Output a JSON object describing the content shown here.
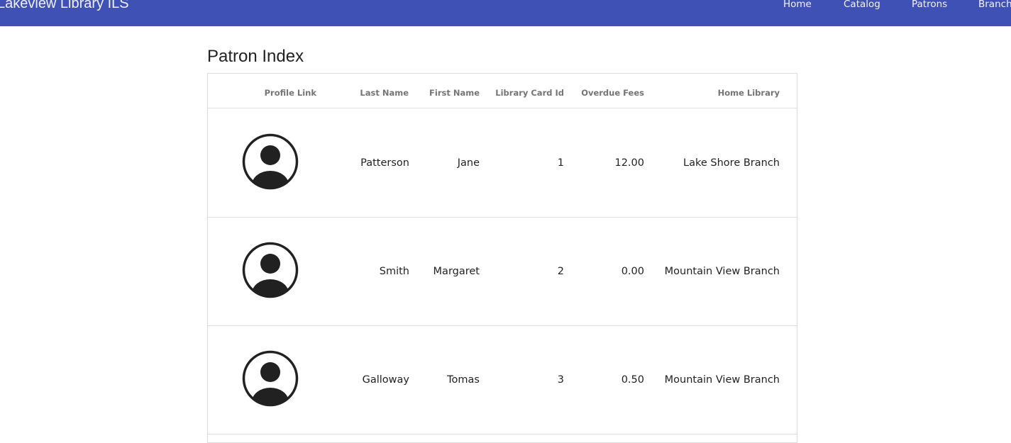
{
  "app": {
    "brand": "Lakeview Library ILS",
    "nav": [
      "Home",
      "Catalog",
      "Patrons",
      "Branche"
    ]
  },
  "page": {
    "title": "Patron Index"
  },
  "table": {
    "columns": [
      "Profile Link",
      "Last Name",
      "First Name",
      "Library Card Id",
      "Overdue Fees",
      "Home Library"
    ],
    "rows": [
      {
        "last_name": "Patterson",
        "first_name": "Jane",
        "card_id": "1",
        "fees": "12.00",
        "home_library": "Lake Shore Branch"
      },
      {
        "last_name": "Smith",
        "first_name": "Margaret",
        "card_id": "2",
        "fees": "0.00",
        "home_library": "Mountain View Branch"
      },
      {
        "last_name": "Galloway",
        "first_name": "Tomas",
        "card_id": "3",
        "fees": "0.50",
        "home_library": "Mountain View Branch"
      }
    ]
  },
  "icons": {
    "profile_avatar": "user-circle-icon"
  },
  "colors": {
    "navbar": "#3f51b5",
    "avatar": "#212121",
    "header_text": "#757575",
    "divider": "#e0e0e0"
  }
}
